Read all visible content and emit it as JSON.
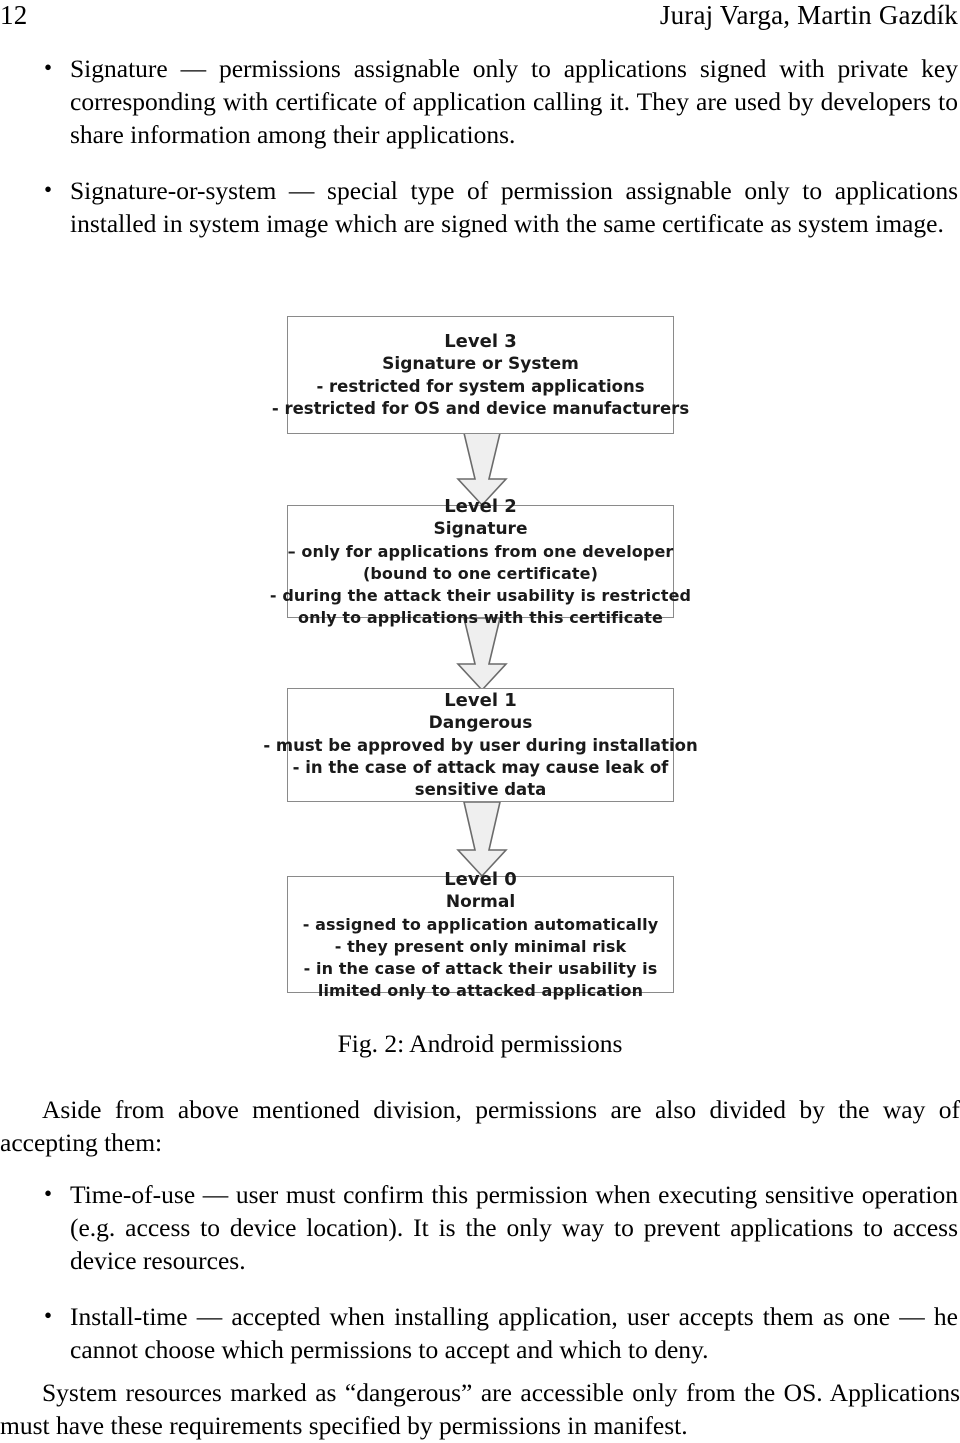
{
  "header": {
    "folio": "12",
    "authors": "Juraj Varga, Martin Gazdík"
  },
  "bullets_top": [
    {
      "term": "Signature",
      "text": "Signature — permissions assignable only to applications signed with private key corresponding with certificate of application calling it. They are used by developers to share information among their applications."
    },
    {
      "term": "Signature-or-system",
      "text": "Signature-or-system — special type of permission assignable only to applications installed in system image which are signed with the same certificate as system image."
    }
  ],
  "figure": {
    "caption": "Fig. 2: Android permissions",
    "boxes": [
      {
        "id": "level-3",
        "title": "Level 3",
        "subtitle": "Signature or System",
        "details": [
          "- restricted for system applications",
          "- restricted for OS and device manufacturers"
        ]
      },
      {
        "id": "level-2",
        "title": "Level 2",
        "subtitle": "Signature",
        "details": [
          "– only for applications from one developer",
          "(bound to one certificate)",
          "- during the attack their usability is restricted",
          "only to applications with this certificate"
        ]
      },
      {
        "id": "level-1",
        "title": "Level 1",
        "subtitle": "Dangerous",
        "details": [
          "- must be approved by user during installation",
          "- in the case of attack may cause leak of",
          "sensitive data"
        ]
      },
      {
        "id": "level-0",
        "title": "Level 0",
        "subtitle": "Normal",
        "details": [
          "- assigned to application automatically",
          "- they present only minimal risk",
          "- in the case of attack their usability is",
          "limited only to attacked application"
        ]
      }
    ],
    "arrow_fill": "#efefef",
    "arrow_stroke": "#6b6b6b",
    "box_border": "#8a8a8a"
  },
  "paragraph_mid": "Aside from above mentioned division, permissions are also divided by the way of accepting them:",
  "bullets_bottom": [
    {
      "term": "Time-of-use",
      "text": "Time-of-use — user must confirm this permission when executing sensitive operation (e.g. access to device location). It is the only way to prevent applications to access device resources."
    },
    {
      "term": "Install-time",
      "text": "Install-time — accepted when installing application, user accepts them as one — he cannot choose which permissions to accept and which to deny."
    }
  ],
  "paragraph_end": "System resources marked as “dangerous” are accessible only from the OS. Applications must have these requirements specified by permissions in manifest."
}
